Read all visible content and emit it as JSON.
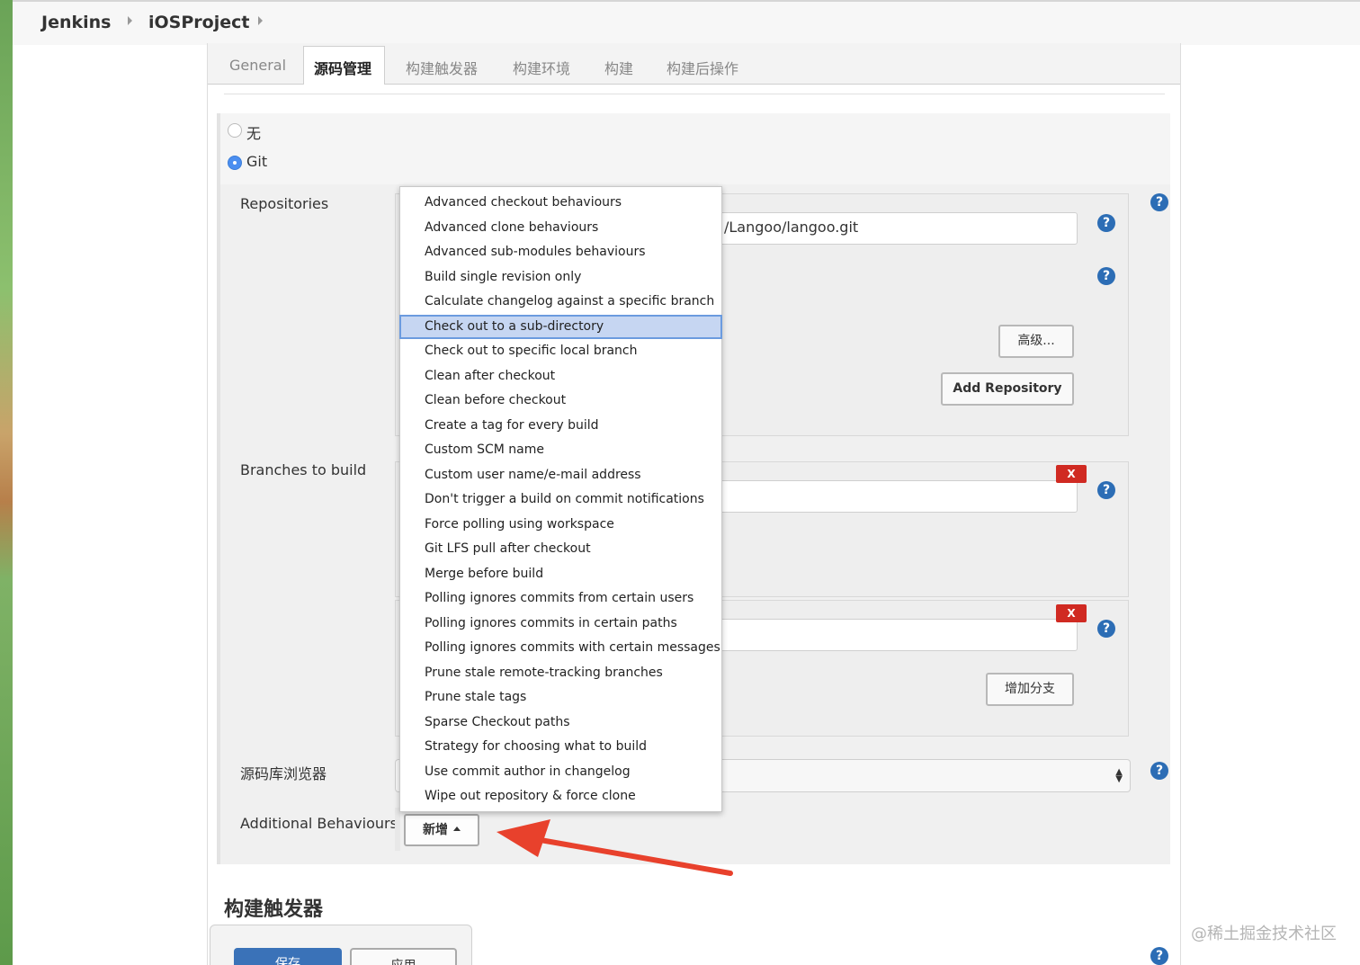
{
  "breadcrumb": {
    "root": "Jenkins",
    "project": "iOSProject"
  },
  "tabs": [
    {
      "label": "General"
    },
    {
      "label": "源码管理"
    },
    {
      "label": "构建触发器"
    },
    {
      "label": "构建环境"
    },
    {
      "label": "构建"
    },
    {
      "label": "构建后操作"
    }
  ],
  "scm": {
    "heading": "源码管理",
    "option_none": "无",
    "option_git": "Git"
  },
  "repositories": {
    "label": "Repositories",
    "url_value": "/Langoo/langoo.git",
    "advanced_button": "高级...",
    "add_button": "Add Repository"
  },
  "branches": {
    "label": "Branches to build",
    "delete_label": "X",
    "add_button": "增加分支"
  },
  "browser": {
    "label": "源码库浏览器",
    "selected": ""
  },
  "behaviours": {
    "label": "Additional Behaviours",
    "add_button": "新增"
  },
  "menu": {
    "items": [
      "Advanced checkout behaviours",
      "Advanced clone behaviours",
      "Advanced sub-modules behaviours",
      "Build single revision only",
      "Calculate changelog against a specific branch",
      "Check out to a sub-directory",
      "Check out to specific local branch",
      "Clean after checkout",
      "Clean before checkout",
      "Create a tag for every build",
      "Custom SCM name",
      "Custom user name/e-mail address",
      "Don't trigger a build on commit notifications",
      "Force polling using workspace",
      "Git LFS pull after checkout",
      "Merge before build",
      "Polling ignores commits from certain users",
      "Polling ignores commits in certain paths",
      "Polling ignores commits with certain messages",
      "Prune stale remote-tracking branches",
      "Prune stale tags",
      "Sparse Checkout paths",
      "Strategy for choosing what to build",
      "Use commit author in changelog",
      "Wipe out repository & force clone"
    ],
    "highlighted": "Check out to a sub-directory"
  },
  "triggers": {
    "heading": "构建触发器"
  },
  "footer": {
    "save": "保存",
    "apply": "应用"
  },
  "help_symbol": "?",
  "watermark": "@稀土掘金技术社区",
  "colors": {
    "accent": "#2c6db5",
    "delete": "#d02a22",
    "arrow": "#e8412c",
    "highlight": "#c6d6f2"
  }
}
